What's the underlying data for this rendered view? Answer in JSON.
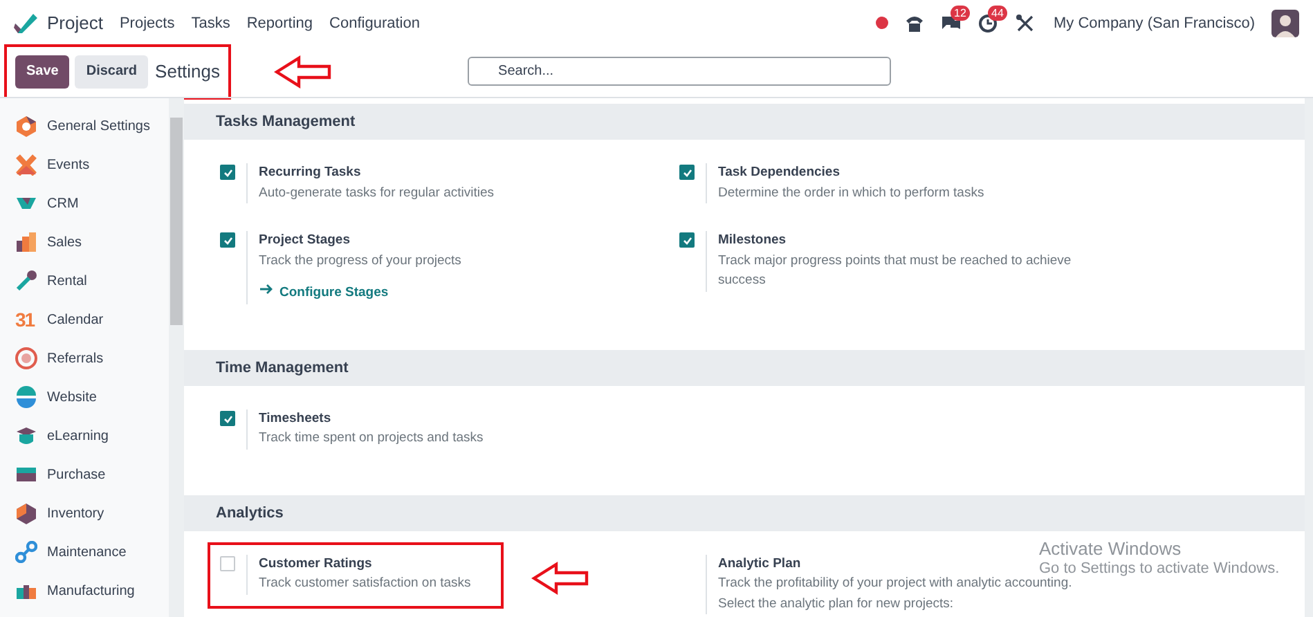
{
  "navbar": {
    "app": "Project",
    "menu": [
      "Projects",
      "Tasks",
      "Reporting",
      "Configuration"
    ],
    "status_dot": {
      "color": "#dc3545"
    },
    "badges": [
      {
        "kind": "messages",
        "count": "12"
      },
      {
        "kind": "activities",
        "count": "44"
      }
    ],
    "company": "My Company (San Francisco)"
  },
  "control_panel": {
    "buttons": [
      {
        "label": "Save",
        "kind": "primary"
      },
      {
        "label": "Discard",
        "kind": "secondary"
      }
    ],
    "breadcrumb": "Settings",
    "highlighted": true,
    "search": {
      "placeholder": "Search..."
    }
  },
  "sidebar": {
    "items": [
      {
        "label": "General Settings",
        "selected": false
      },
      {
        "label": "Events",
        "selected": false
      },
      {
        "label": "CRM",
        "selected": false
      },
      {
        "label": "Sales",
        "selected": false
      },
      {
        "label": "Rental",
        "selected": false
      },
      {
        "label": "Calendar",
        "selected": false,
        "icon_text": "31"
      },
      {
        "label": "Referrals",
        "selected": false
      },
      {
        "label": "Website",
        "selected": false
      },
      {
        "label": "eLearning",
        "selected": false
      },
      {
        "label": "Purchase",
        "selected": false
      },
      {
        "label": "Inventory",
        "selected": false
      },
      {
        "label": "Maintenance",
        "selected": false
      },
      {
        "label": "Manufacturing",
        "selected": false
      }
    ]
  },
  "sections": [
    {
      "title": "Tasks Management",
      "settings": [
        {
          "kind": "checkbox",
          "title": "Recurring Tasks",
          "description": "Auto-generate tasks for regular activities",
          "checked": true,
          "highlighted": false
        },
        {
          "kind": "checkbox",
          "title": "Task Dependencies",
          "description": "Determine the order in which to perform tasks",
          "checked": true,
          "highlighted": false
        },
        {
          "kind": "checkbox",
          "title": "Project Stages",
          "description": "Track the progress of your projects",
          "checked": true,
          "highlighted": false,
          "link": "Configure Stages"
        },
        {
          "kind": "checkbox",
          "title": "Milestones",
          "description": "Track major progress points that must be reached to achieve success",
          "checked": true,
          "highlighted": false
        }
      ]
    },
    {
      "title": "Time Management",
      "settings": [
        {
          "kind": "checkbox",
          "title": "Timesheets",
          "description": "Track time spent on projects and tasks",
          "checked": true,
          "highlighted": false
        }
      ]
    },
    {
      "title": "Analytics",
      "settings": [
        {
          "kind": "checkbox",
          "title": "Customer Ratings",
          "description": "Track customer satisfaction on tasks",
          "checked": false,
          "highlighted": true
        },
        {
          "kind": "info",
          "title": "Analytic Plan",
          "description": "Track the profitability of your project with analytic accounting.",
          "note": "Select the analytic plan for new projects:",
          "highlighted": false
        }
      ]
    }
  ],
  "os_notice": {
    "title": "Activate Windows",
    "subtitle": "Go to Settings to activate Windows."
  }
}
